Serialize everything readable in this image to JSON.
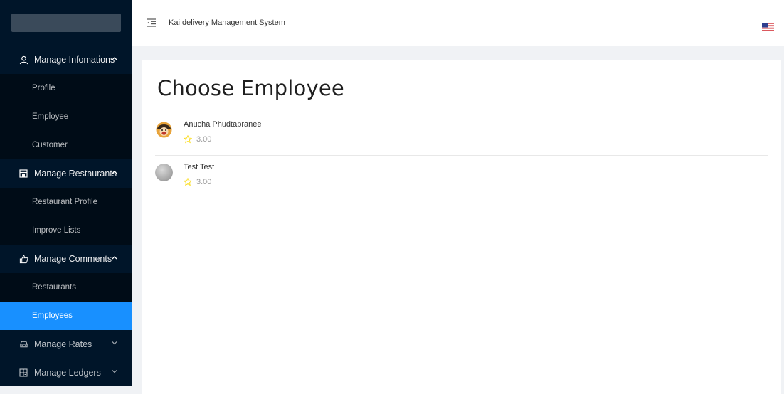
{
  "header": {
    "title": "Kai delivery Management System",
    "fold_icon": "menu-fold-icon",
    "language_icon": "us-flag-icon"
  },
  "sidebar": {
    "groups": [
      {
        "label": "Manage Infomations",
        "icon": "user-icon",
        "expanded": true,
        "items": [
          "Profile",
          "Employee",
          "Customer"
        ]
      },
      {
        "label": "Manage Restaurants",
        "icon": "shop-icon",
        "expanded": true,
        "items": [
          "Restaurant Profile",
          "Improve Lists"
        ]
      },
      {
        "label": "Manage Comments",
        "icon": "like-icon",
        "expanded": true,
        "items": [
          "Restaurants",
          "Employees"
        ],
        "active_item": "Employees"
      },
      {
        "label": "Manage Rates",
        "icon": "car-icon",
        "expanded": false,
        "items": []
      },
      {
        "label": "Manage Ledgers",
        "icon": "calculator-icon",
        "expanded": false,
        "items": []
      }
    ]
  },
  "main": {
    "title": "Choose Employee",
    "employees": [
      {
        "name": "Anucha Phudtapranee",
        "rating": "3.00"
      },
      {
        "name": "Test Test",
        "rating": "3.00"
      }
    ]
  },
  "colors": {
    "sidebar_bg": "#001529",
    "submenu_bg": "#000c17",
    "active": "#1890ff",
    "star": "#fadb14"
  }
}
